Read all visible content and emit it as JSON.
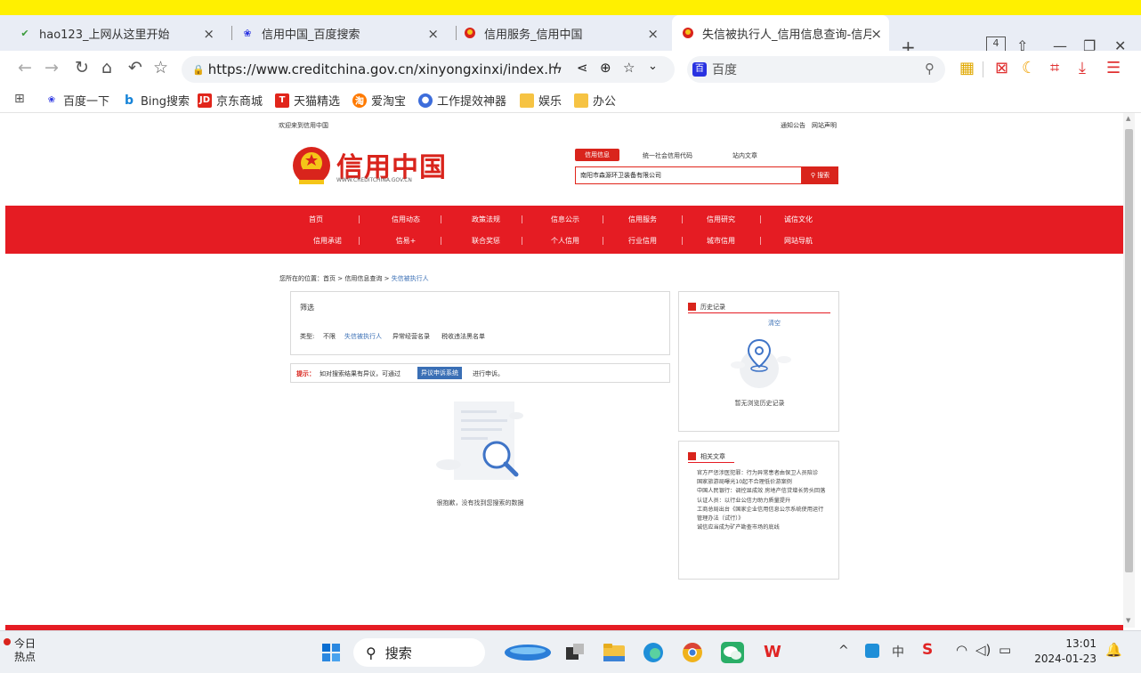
{
  "browser": {
    "tabs": [
      {
        "label": "hao123_上网从这里开始",
        "active": false
      },
      {
        "label": "信用中国_百度搜索",
        "active": false
      },
      {
        "label": "信用服务_信用中国",
        "active": false
      },
      {
        "label": "失信被执行人_信用信息查询-信月",
        "active": true
      }
    ],
    "tab_count": "4",
    "url": "https://www.creditchina.gov.cn/xinyongxinxi/index.ht...",
    "url_host": "www.creditchina.gov.cn",
    "search_engine": "百度",
    "bookmarks": [
      "百度一下",
      "Bing搜索",
      "京东商城",
      "天猫精选",
      "爱淘宝",
      "工作提效神器",
      "娱乐",
      "办公"
    ]
  },
  "site": {
    "welcome": "欢迎来到信用中国",
    "top_links": [
      "通知公告",
      "网站声明"
    ],
    "logo_text": "信用中国",
    "logo_url": "WWW.CREDITCHINA.GOV.CN",
    "search_tabs": [
      "信用信息",
      "统一社会信用代码",
      "站内文章"
    ],
    "search_value": "南阳市森源环卫装备有限公司",
    "search_button": "搜索",
    "nav_row1": [
      "首页",
      "信用动态",
      "政策法规",
      "信息公示",
      "信用服务",
      "信用研究",
      "诚信文化"
    ],
    "nav_row2": [
      "信用承诺",
      "信易+",
      "联合奖惩",
      "个人信用",
      "行业信用",
      "城市信用",
      "网站导航"
    ],
    "breadcrumb_prefix": "您所在的位置：",
    "breadcrumb": [
      "首页",
      "信用信息查询",
      "失信被执行人"
    ],
    "breadcrumb_sep": ">",
    "filter_title": "筛选",
    "filter_type_label": "类型:",
    "filter_types": [
      "不限",
      "失信被执行人",
      "异常经营名录",
      "税收违法黑名单"
    ],
    "tip_label": "提示：",
    "tip_text": "如对搜索结果有异议，可通过",
    "tip_button": "异议申诉系统",
    "tip_suffix": "进行申诉。",
    "empty_text": "很抱歉，没有找到您搜索的数据",
    "history_title": "历史记录",
    "history_clear": "清空",
    "history_empty": "暂无浏览历史记录",
    "articles_title": "相关文章",
    "articles": [
      "官方严惩涉医犯罪：行为异常患者由保卫人员陪诊",
      "国家旅游局曝光10起不合理低价游案例",
      "中国人民银行：调控显成效 房地产信贷增长势头回落",
      "认证人员：以行业公信力助力质量提升",
      "工商总局出台《国家企业信用信息公示系统使用运行管理办法（试行）》",
      "诚信应当成为矿产勘查市场的底线"
    ]
  },
  "taskbar": {
    "weather_line1": "今日",
    "weather_line2": "热点",
    "search_label": "搜索",
    "ime": "中",
    "time": "13:01",
    "date": "2024-01-23"
  }
}
